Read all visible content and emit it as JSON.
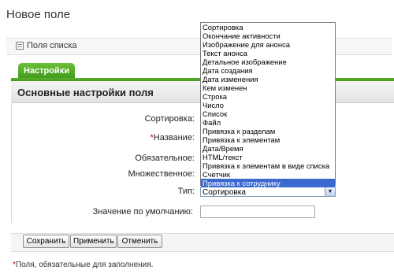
{
  "page": {
    "title": "Новое поле"
  },
  "toolbar": {
    "list_fields_label": "Поля списка"
  },
  "tabs": [
    {
      "label": "Настройки"
    }
  ],
  "section": {
    "title": "Основные настройки поля"
  },
  "form": {
    "sort_label": "Сортировка:",
    "required_mark": "*",
    "name_label": "Название:",
    "mandatory_label": "Обязательное:",
    "multiple_label": "Множественное:",
    "type_label": "Тип:",
    "type_value": "Сортировка",
    "default_label": "Значение по умолчанию:",
    "default_value": ""
  },
  "type_options": [
    "Сортировка",
    "Окончание активности",
    "Изображение для анонса",
    "Текст анонса",
    "Детальное изображение",
    "Дата создания",
    "Дата изменения",
    "Кем изменен",
    "Строка",
    "Число",
    "Список",
    "Файл",
    "Привязка к разделам",
    "Привязка к элементам",
    "Дата/Время",
    "HTML/текст",
    "Привязка к элементам в виде списка",
    "Счетчик",
    "Привязка к сотруднику"
  ],
  "type_options_selected_index": 18,
  "buttons": {
    "save": "Сохранить",
    "apply": "Применить",
    "cancel": "Отменить"
  },
  "footnote": {
    "mark": "*",
    "text": "Поля, обязательные для заполнения."
  },
  "colors": {
    "tab_green": "#3f9a1b",
    "selection_blue": "#3b69d0",
    "required_red": "#cc0000"
  }
}
